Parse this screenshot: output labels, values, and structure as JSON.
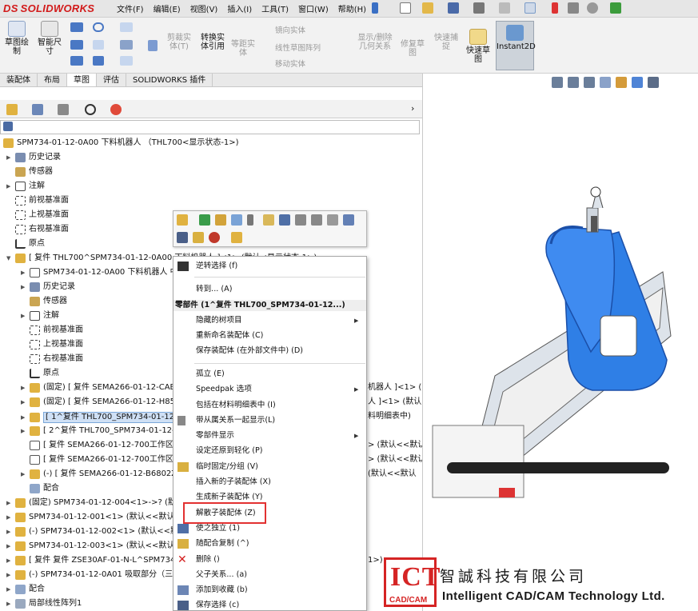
{
  "app": {
    "brand": "SOLIDWORKS",
    "brand_prefix": "DS"
  },
  "menu": [
    "文件(F)",
    "编辑(E)",
    "视图(V)",
    "插入(I)",
    "工具(T)",
    "窗口(W)",
    "帮助(H)"
  ],
  "ribbon": {
    "sketch_draw": "草图绘\n制",
    "smart_dim": "智能尺\n寸",
    "trim": "剪裁实\n体(T)",
    "convert": "转换实\n体引用",
    "offset": "等距实\n体",
    "mirror": "镜向实体",
    "linear_pattern": "线性草图阵列",
    "move": "移动实体",
    "show_relations": "显示/删除\n几何关系",
    "repair": "修复草\n图",
    "quick_snap": "快速捕\n捉",
    "quick_sketch": "快速草\n图",
    "instant2d": "Instant2D"
  },
  "tabs": [
    "装配体",
    "布局",
    "草图",
    "评估",
    "SOLIDWORKS 插件"
  ],
  "active_tab": "草图",
  "tree": {
    "root": "SPM734-01-12-0A00 下料机器人 （THL700<显示状态-1>)",
    "items": [
      "历史记录",
      "传感器",
      "注解",
      "前视基准面",
      "上视基准面",
      "右视基准面",
      "原点",
      "[ 复件 THL700^SPM734-01-12-0A00 下料机器人 ]<1> (默认<显示状态-1>)",
      "SPM734-01-12-0A00 下料机器人 中",
      "历史记录",
      "传感器",
      "注解",
      "前视基准面",
      "上视基准面",
      "右视基准面",
      "原点",
      "(固定) [ 复件 SEMA266-01-12-CAB",
      "(固定) [ 复件 SEMA266-01-12-H85",
      "[ 1^复件 THL700_SPM734-01-12-0",
      "[ 2^复件 THL700_SPM734-01-12-0",
      "[ 复件 SEMA266-01-12-700工作区块",
      "[ 复件 SEMA266-01-12-700工作区块",
      "(-) [ 复件 SEMA266-01-12-B6802Z",
      "配合",
      "(固定) SPM734-01-12-004<1>->? (默认",
      "SPM734-01-12-001<1> (默认<<默认",
      "(-) SPM734-01-12-002<1> (默认<<默",
      "SPM734-01-12-003<1> (默认<<默认",
      "[ 复件 复件 ZSE30AF-01-N-L^SPM734-",
      "(-) SPM734-01-12-0A01 吸取部分（三",
      "配合",
      "局部线性阵列1"
    ],
    "right_fragments": [
      "机器人 ]<1> (",
      "人 ]<1> (默认<",
      "料明细表中)",
      "> (默认<<默认",
      "> (默认<<默认",
      "(默认<<默认",
      "1>)"
    ]
  },
  "context_menu": {
    "reverse_select": "逆转选择 (f)",
    "goto": "转到... (A)",
    "header": "零部件 (1^复件 THL700_SPM734-01-12...)",
    "items": [
      "隐藏的树项目",
      "重新命名装配体 (C)",
      "保存装配体 (在外部文件中) (D)",
      "孤立 (E)",
      "Speedpak 选项",
      "包括在材料明细表中 (I)",
      "带从属关系一起显示(L)",
      "零部件显示",
      "设定还原到轻化 (P)",
      "临时固定/分组 (V)",
      "插入新的子装配体 (X)",
      "生成新子装配体 (Y)",
      "解散子装配体 (Z)",
      "使之独立 (1)",
      "随配合复制 (^)",
      "删除 ()",
      "父子关系... (a)",
      "添加到收藏 (b)",
      "保存选择 (c)"
    ]
  },
  "watermark": {
    "ict": "ICT",
    "cadcam": "CAD/CAM",
    "cn": "智誠科技有限公司",
    "en": "Intelligent CAD/CAM Technology Ltd."
  },
  "colors": {
    "brand_red": "#d21a1a",
    "arm_blue": "#2f7fe6",
    "highlight_red": "#e23131"
  }
}
